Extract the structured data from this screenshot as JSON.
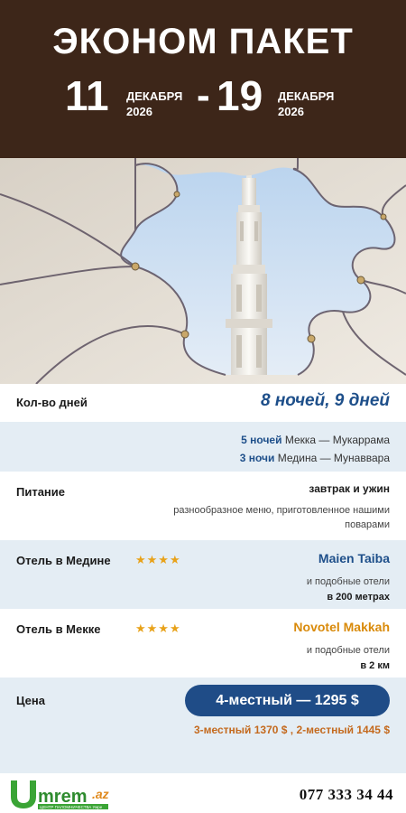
{
  "header": {
    "title": "ЭКОНОМ ПАКЕТ",
    "start_day": "11",
    "start_month": "ДЕКАБРЯ",
    "start_year": "2026",
    "dash": "-",
    "end_day": "19",
    "end_month": "ДЕКАБРЯ",
    "end_year": "2026"
  },
  "duration": {
    "label": "Кол-во дней",
    "value": "8 ночей, 9 дней",
    "mecca_nights": "5 ночей",
    "mecca_city": "Мекка — Мукаррама",
    "medina_nights": "3 ночи",
    "medina_city": "Медина — Мунаввара"
  },
  "food": {
    "label": "Питание",
    "value": "завтрак и ужин",
    "note": "разнообразное меню, приготовленное нашими поварами"
  },
  "hotel_medina": {
    "label": "Отель в Медине",
    "stars": "★★★★",
    "rating": 4,
    "name": "Maien Taiba",
    "name_color": "#1e4f8a",
    "note": "и подобные отели",
    "distance": "в 200 метрах"
  },
  "hotel_mecca": {
    "label": "Отель в Мекке",
    "stars": "★★★★",
    "rating": 4,
    "name": "Novotel Makkah",
    "name_color": "#d98a0a",
    "note": "и подобные отели",
    "distance": "в 2 км"
  },
  "price": {
    "label": "Цена",
    "main": "4-местный — 1295 $",
    "alternatives": "3-местный 1370 $  ,  2-местный 1445 $"
  },
  "footer": {
    "logo_text": "Umrem",
    "logo_suffix": ".az",
    "logo_tagline": "ЦЕНТР ПАЛОМНИЧЕСТВА Умре",
    "phone": "077 333 34 44"
  },
  "colors": {
    "header_bg": "#3d2619",
    "accent_blue": "#1f4c87",
    "accent_orange": "#c46a1e",
    "row_alt_bg": "#e4edf4",
    "logo_green": "#3aa435"
  }
}
